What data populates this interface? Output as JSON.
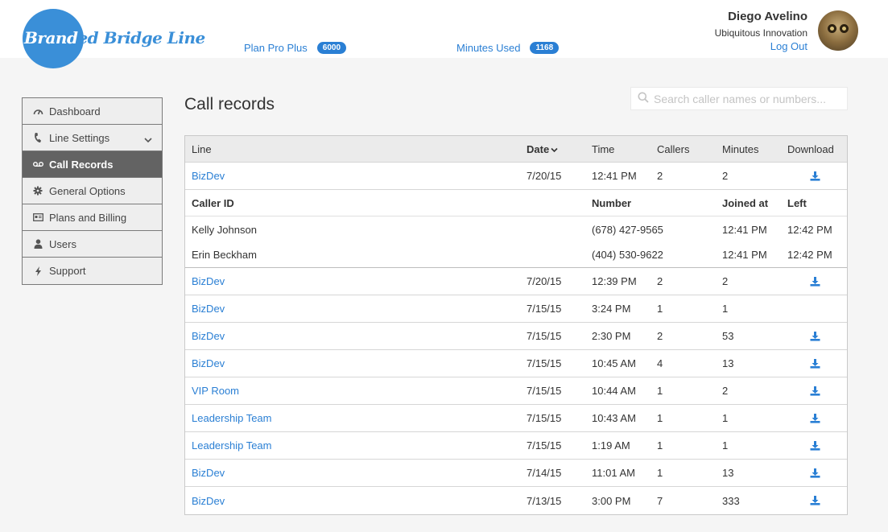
{
  "header": {
    "logo_text_a": "Brand",
    "logo_text_b": "ed Bridge Line",
    "plan_label": "Plan Pro Plus",
    "plan_value": "6000",
    "minutes_label": "Minutes Used",
    "minutes_value": "1168",
    "user_name": "Diego Avelino",
    "user_company": "Ubiquitous Innovation",
    "logout_label": "Log Out"
  },
  "sidebar": {
    "items": [
      {
        "label": "Dashboard",
        "icon": "gauge-icon"
      },
      {
        "label": "Line Settings",
        "icon": "phone-icon"
      },
      {
        "label": "Call Records",
        "icon": "voicemail-icon"
      },
      {
        "label": "General Options",
        "icon": "gear-icon"
      },
      {
        "label": "Plans and Billing",
        "icon": "billing-icon"
      },
      {
        "label": "Users",
        "icon": "user-icon"
      },
      {
        "label": "Support",
        "icon": "bolt-icon"
      }
    ],
    "active_index": 2
  },
  "main": {
    "title": "Call records",
    "search_placeholder": "Search caller names or numbers...",
    "columns": {
      "line": "Line",
      "date": "Date",
      "time": "Time",
      "callers": "Callers",
      "minutes": "Minutes",
      "download": "Download"
    },
    "expanded": {
      "line": "BizDev",
      "date": "7/20/15",
      "time": "12:41 PM",
      "callers": "2",
      "minutes": "2",
      "sub_columns": {
        "caller_id": "Caller ID",
        "number": "Number",
        "joined": "Joined at",
        "left": "Left"
      },
      "callers_list": [
        {
          "name": "Kelly Johnson",
          "number": "(678) 427-9565",
          "joined": "12:41 PM",
          "left": "12:42 PM"
        },
        {
          "name": "Erin Beckham",
          "number": "(404) 530-9622",
          "joined": "12:41 PM",
          "left": "12:42 PM"
        }
      ]
    },
    "rows": [
      {
        "line": "BizDev",
        "date": "7/20/15",
        "time": "12:39 PM",
        "callers": "2",
        "minutes": "2",
        "download": true
      },
      {
        "line": "BizDev",
        "date": "7/15/15",
        "time": "3:24 PM",
        "callers": "1",
        "minutes": "1",
        "download": false
      },
      {
        "line": "BizDev",
        "date": "7/15/15",
        "time": "2:30 PM",
        "callers": "2",
        "minutes": "53",
        "download": true
      },
      {
        "line": "BizDev",
        "date": "7/15/15",
        "time": "10:45 AM",
        "callers": "4",
        "minutes": "13",
        "download": true
      },
      {
        "line": "VIP Room",
        "date": "7/15/15",
        "time": "10:44 AM",
        "callers": "1",
        "minutes": "2",
        "download": true
      },
      {
        "line": "Leadership Team",
        "date": "7/15/15",
        "time": "10:43 AM",
        "callers": "1",
        "minutes": "1",
        "download": true
      },
      {
        "line": "Leadership Team",
        "date": "7/15/15",
        "time": "1:19 AM",
        "callers": "1",
        "minutes": "1",
        "download": true
      },
      {
        "line": "BizDev",
        "date": "7/14/15",
        "time": "11:01 AM",
        "callers": "1",
        "minutes": "13",
        "download": true
      },
      {
        "line": "BizDev",
        "date": "7/13/15",
        "time": "3:00 PM",
        "callers": "7",
        "minutes": "333",
        "download": true
      }
    ]
  },
  "colors": {
    "accent": "#2a7fd4",
    "logo": "#3a8fd8",
    "active_nav": "#636363"
  }
}
